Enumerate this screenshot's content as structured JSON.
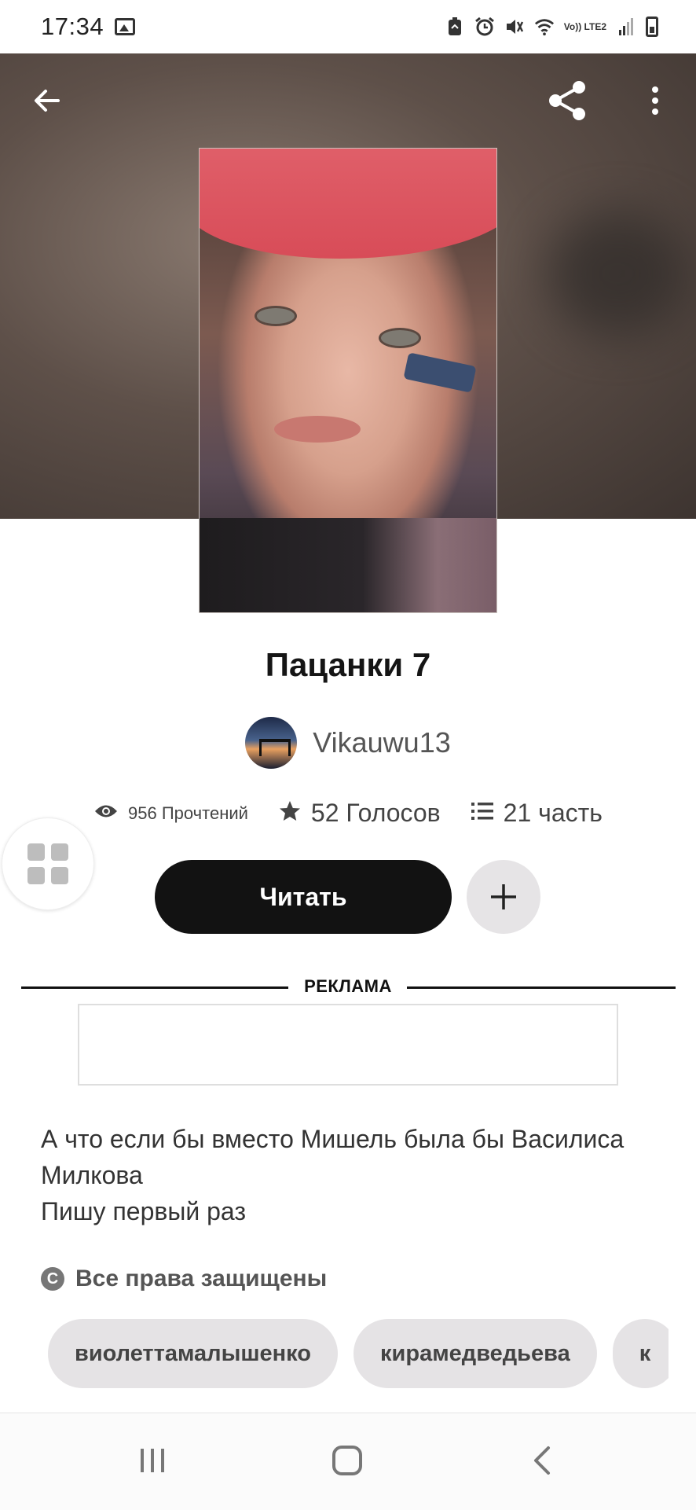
{
  "status_bar": {
    "time": "17:34",
    "network_label": "Vo)) LTE2",
    "icons": [
      "image-icon",
      "recycle-icon",
      "alarm-icon",
      "mute-icon",
      "wifi-icon",
      "signal-icon",
      "battery-icon"
    ]
  },
  "toolbar": {
    "back_icon": "arrow-left-icon",
    "share_icon": "share-icon",
    "menu_icon": "more-vert-icon"
  },
  "story": {
    "title": "Пацанки 7",
    "author": "Vikauwu13",
    "stats": {
      "reads": "956 Прочтений",
      "votes": "52 Голосов",
      "parts": "21 часть"
    },
    "read_button": "Читать",
    "add_button_icon": "plus-icon",
    "description_lines": [
      "А что если бы вместо Мишель была бы Василиса",
      "Милкова",
      "Пишу первый раз"
    ],
    "copyright_icon_text": "C",
    "copyright": "Все права защищены",
    "tags": [
      "виолеттамалышенко",
      "кирамедведьева",
      "к"
    ]
  },
  "ad": {
    "label": "РЕКЛАМА"
  },
  "colors": {
    "accent": "#121212",
    "chip_bg": "#e5e3e5",
    "hero_bg": "#5e5049"
  }
}
